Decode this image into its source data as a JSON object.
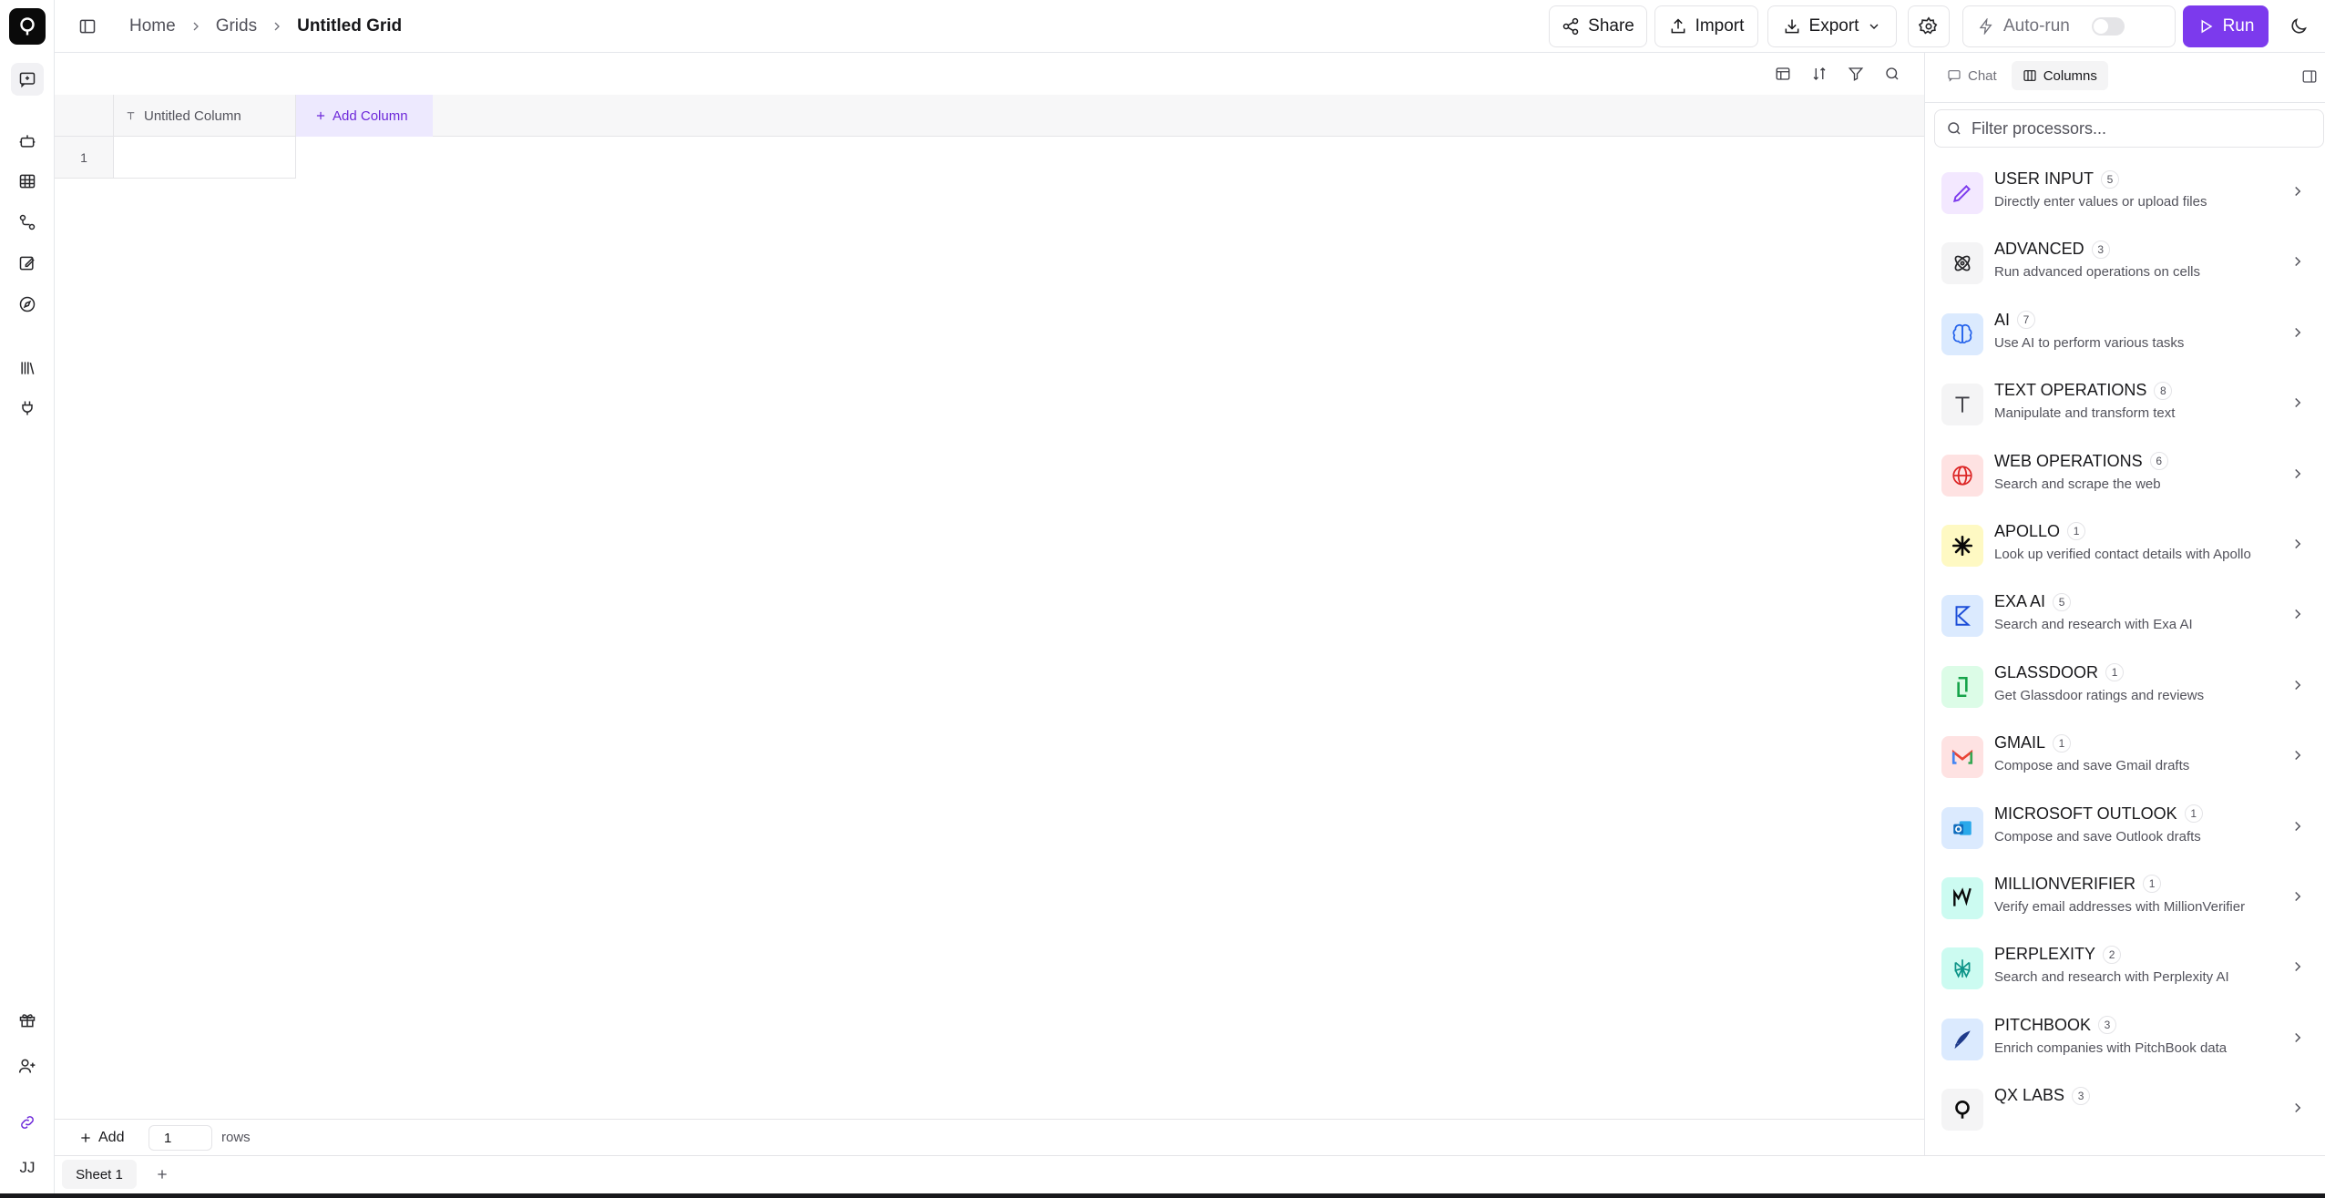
{
  "breadcrumb": {
    "home": "Home",
    "grids": "Grids",
    "current": "Untitled Grid"
  },
  "toolbar": {
    "share_label": "Share",
    "import_label": "Import",
    "export_label": "Export",
    "autorun_label": "Auto-run",
    "autorun_enabled": false,
    "run_label": "Run"
  },
  "colors": {
    "accent": "#7c3aed",
    "accent_light": "#ede9fe",
    "logo_bg": "#0a0a0a"
  },
  "rail": {
    "icons": [
      "chat-icon",
      "robot-icon",
      "table-icon",
      "workflow-icon",
      "edit-doc-icon",
      "compass-icon",
      "library-icon",
      "plug-icon",
      "gift-icon",
      "add-user-icon",
      "integration-icon"
    ],
    "avatar_initials": "JJ"
  },
  "grid": {
    "columns": [
      {
        "name": "Untitled Column",
        "type": "text"
      }
    ],
    "add_column_label": "Add Column",
    "rows": [
      {
        "number": "1",
        "cells": [
          ""
        ]
      }
    ]
  },
  "footer": {
    "add_label": "Add",
    "row_count": "1",
    "rows_label": "rows"
  },
  "sheets": {
    "tabs": [
      "Sheet 1"
    ],
    "active": "Sheet 1"
  },
  "panel": {
    "tabs": [
      {
        "label": "Chat"
      },
      {
        "label": "Columns"
      }
    ],
    "active_tab": "Columns",
    "filter_placeholder": "Filter processors...",
    "processors": [
      {
        "name": "USER INPUT",
        "count": "5",
        "description": "Directly enter values or upload files",
        "icon": "pencil-icon",
        "color": "#7c3aed",
        "bg": "#f3e8ff"
      },
      {
        "name": "ADVANCED",
        "count": "3",
        "description": "Run advanced operations on cells",
        "icon": "atom-icon",
        "color": "#27272a",
        "bg": "#f4f4f5"
      },
      {
        "name": "AI",
        "count": "7",
        "description": "Use AI to perform various tasks",
        "icon": "brain-icon",
        "color": "#2563eb",
        "bg": "#dbeafe"
      },
      {
        "name": "TEXT OPERATIONS",
        "count": "8",
        "description": "Manipulate and transform text",
        "icon": "text-icon",
        "color": "#3f3f46",
        "bg": "#f4f4f5"
      },
      {
        "name": "WEB OPERATIONS",
        "count": "6",
        "description": "Search and scrape the web",
        "icon": "globe-icon",
        "color": "#dc2626",
        "bg": "#fee2e2"
      },
      {
        "name": "APOLLO",
        "count": "1",
        "description": "Look up verified contact details with Apollo",
        "icon": "apollo-icon",
        "color": "#0a0a0a",
        "bg": "#fef9c3"
      },
      {
        "name": "EXA AI",
        "count": "5",
        "description": "Search and research with Exa AI",
        "icon": "exa-icon",
        "color": "#1d4ed8",
        "bg": "#dbeafe"
      },
      {
        "name": "GLASSDOOR",
        "count": "1",
        "description": "Get Glassdoor ratings and reviews",
        "icon": "glassdoor-icon",
        "color": "#16a34a",
        "bg": "#dcfce7"
      },
      {
        "name": "GMAIL",
        "count": "1",
        "description": "Compose and save Gmail drafts",
        "icon": "gmail-icon",
        "color": "#ea4335",
        "bg": "#fee2e2"
      },
      {
        "name": "MICROSOFT OUTLOOK",
        "count": "1",
        "description": "Compose and save Outlook drafts",
        "icon": "outlook-icon",
        "color": "#0f6cbd",
        "bg": "#dbeafe"
      },
      {
        "name": "MILLIONVERIFIER",
        "count": "1",
        "description": "Verify email addresses with MillionVerifier",
        "icon": "millionverifier-icon",
        "color": "#0a0a0a",
        "bg": "#ccfbf1"
      },
      {
        "name": "PERPLEXITY",
        "count": "2",
        "description": "Search and research with Perplexity AI",
        "icon": "perplexity-icon",
        "color": "#0d9488",
        "bg": "#ccfbf1"
      },
      {
        "name": "PITCHBOOK",
        "count": "3",
        "description": "Enrich companies with PitchBook data",
        "icon": "pitchbook-icon",
        "color": "#1e3a8a",
        "bg": "#dbeafe"
      },
      {
        "name": "QX LABS",
        "count": "3",
        "description": "",
        "icon": "qxlabs-icon",
        "color": "#0a0a0a",
        "bg": "#f4f4f5"
      }
    ]
  }
}
